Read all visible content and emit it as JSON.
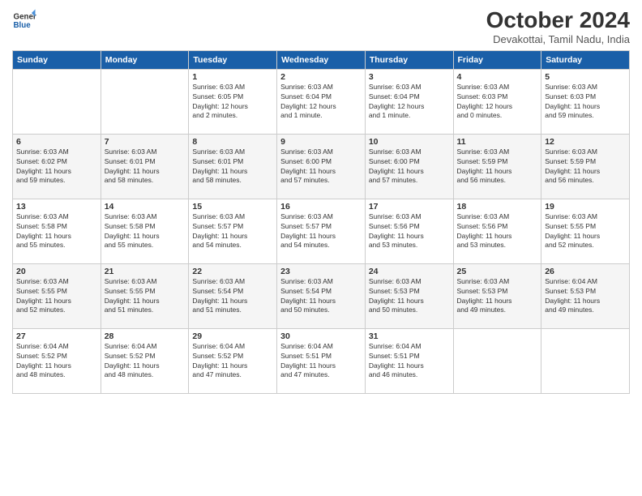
{
  "logo": {
    "line1": "General",
    "line2": "Blue"
  },
  "header": {
    "month": "October 2024",
    "location": "Devakottai, Tamil Nadu, India"
  },
  "weekdays": [
    "Sunday",
    "Monday",
    "Tuesday",
    "Wednesday",
    "Thursday",
    "Friday",
    "Saturday"
  ],
  "weeks": [
    [
      {
        "day": "",
        "info": ""
      },
      {
        "day": "",
        "info": ""
      },
      {
        "day": "1",
        "info": "Sunrise: 6:03 AM\nSunset: 6:05 PM\nDaylight: 12 hours\nand 2 minutes."
      },
      {
        "day": "2",
        "info": "Sunrise: 6:03 AM\nSunset: 6:04 PM\nDaylight: 12 hours\nand 1 minute."
      },
      {
        "day": "3",
        "info": "Sunrise: 6:03 AM\nSunset: 6:04 PM\nDaylight: 12 hours\nand 1 minute."
      },
      {
        "day": "4",
        "info": "Sunrise: 6:03 AM\nSunset: 6:03 PM\nDaylight: 12 hours\nand 0 minutes."
      },
      {
        "day": "5",
        "info": "Sunrise: 6:03 AM\nSunset: 6:03 PM\nDaylight: 11 hours\nand 59 minutes."
      }
    ],
    [
      {
        "day": "6",
        "info": "Sunrise: 6:03 AM\nSunset: 6:02 PM\nDaylight: 11 hours\nand 59 minutes."
      },
      {
        "day": "7",
        "info": "Sunrise: 6:03 AM\nSunset: 6:01 PM\nDaylight: 11 hours\nand 58 minutes."
      },
      {
        "day": "8",
        "info": "Sunrise: 6:03 AM\nSunset: 6:01 PM\nDaylight: 11 hours\nand 58 minutes."
      },
      {
        "day": "9",
        "info": "Sunrise: 6:03 AM\nSunset: 6:00 PM\nDaylight: 11 hours\nand 57 minutes."
      },
      {
        "day": "10",
        "info": "Sunrise: 6:03 AM\nSunset: 6:00 PM\nDaylight: 11 hours\nand 57 minutes."
      },
      {
        "day": "11",
        "info": "Sunrise: 6:03 AM\nSunset: 5:59 PM\nDaylight: 11 hours\nand 56 minutes."
      },
      {
        "day": "12",
        "info": "Sunrise: 6:03 AM\nSunset: 5:59 PM\nDaylight: 11 hours\nand 56 minutes."
      }
    ],
    [
      {
        "day": "13",
        "info": "Sunrise: 6:03 AM\nSunset: 5:58 PM\nDaylight: 11 hours\nand 55 minutes."
      },
      {
        "day": "14",
        "info": "Sunrise: 6:03 AM\nSunset: 5:58 PM\nDaylight: 11 hours\nand 55 minutes."
      },
      {
        "day": "15",
        "info": "Sunrise: 6:03 AM\nSunset: 5:57 PM\nDaylight: 11 hours\nand 54 minutes."
      },
      {
        "day": "16",
        "info": "Sunrise: 6:03 AM\nSunset: 5:57 PM\nDaylight: 11 hours\nand 54 minutes."
      },
      {
        "day": "17",
        "info": "Sunrise: 6:03 AM\nSunset: 5:56 PM\nDaylight: 11 hours\nand 53 minutes."
      },
      {
        "day": "18",
        "info": "Sunrise: 6:03 AM\nSunset: 5:56 PM\nDaylight: 11 hours\nand 53 minutes."
      },
      {
        "day": "19",
        "info": "Sunrise: 6:03 AM\nSunset: 5:55 PM\nDaylight: 11 hours\nand 52 minutes."
      }
    ],
    [
      {
        "day": "20",
        "info": "Sunrise: 6:03 AM\nSunset: 5:55 PM\nDaylight: 11 hours\nand 52 minutes."
      },
      {
        "day": "21",
        "info": "Sunrise: 6:03 AM\nSunset: 5:55 PM\nDaylight: 11 hours\nand 51 minutes."
      },
      {
        "day": "22",
        "info": "Sunrise: 6:03 AM\nSunset: 5:54 PM\nDaylight: 11 hours\nand 51 minutes."
      },
      {
        "day": "23",
        "info": "Sunrise: 6:03 AM\nSunset: 5:54 PM\nDaylight: 11 hours\nand 50 minutes."
      },
      {
        "day": "24",
        "info": "Sunrise: 6:03 AM\nSunset: 5:53 PM\nDaylight: 11 hours\nand 50 minutes."
      },
      {
        "day": "25",
        "info": "Sunrise: 6:03 AM\nSunset: 5:53 PM\nDaylight: 11 hours\nand 49 minutes."
      },
      {
        "day": "26",
        "info": "Sunrise: 6:04 AM\nSunset: 5:53 PM\nDaylight: 11 hours\nand 49 minutes."
      }
    ],
    [
      {
        "day": "27",
        "info": "Sunrise: 6:04 AM\nSunset: 5:52 PM\nDaylight: 11 hours\nand 48 minutes."
      },
      {
        "day": "28",
        "info": "Sunrise: 6:04 AM\nSunset: 5:52 PM\nDaylight: 11 hours\nand 48 minutes."
      },
      {
        "day": "29",
        "info": "Sunrise: 6:04 AM\nSunset: 5:52 PM\nDaylight: 11 hours\nand 47 minutes."
      },
      {
        "day": "30",
        "info": "Sunrise: 6:04 AM\nSunset: 5:51 PM\nDaylight: 11 hours\nand 47 minutes."
      },
      {
        "day": "31",
        "info": "Sunrise: 6:04 AM\nSunset: 5:51 PM\nDaylight: 11 hours\nand 46 minutes."
      },
      {
        "day": "",
        "info": ""
      },
      {
        "day": "",
        "info": ""
      }
    ]
  ]
}
